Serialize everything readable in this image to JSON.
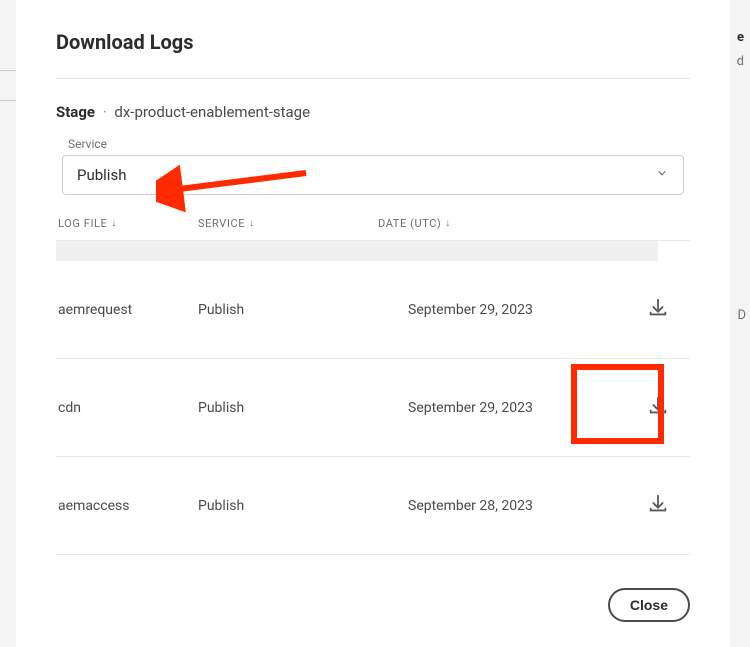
{
  "modal": {
    "title": "Download Logs",
    "stage_label": "Stage",
    "stage_name": "dx-product-enablement-stage",
    "service_label": "Service",
    "service_value": "Publish",
    "close_label": "Close"
  },
  "columns": {
    "log_file": "LOG FILE",
    "service": "SERVICE",
    "date": "DATE (UTC)"
  },
  "rows": [
    {
      "log_file": "aemrequest",
      "service": "Publish",
      "date": "September 29, 2023"
    },
    {
      "log_file": "cdn",
      "service": "Publish",
      "date": "September 29, 2023"
    },
    {
      "log_file": "aemaccess",
      "service": "Publish",
      "date": "September 28, 2023"
    }
  ],
  "bg": {
    "frag1": "e",
    "frag2": "d",
    "frag3": "D"
  }
}
